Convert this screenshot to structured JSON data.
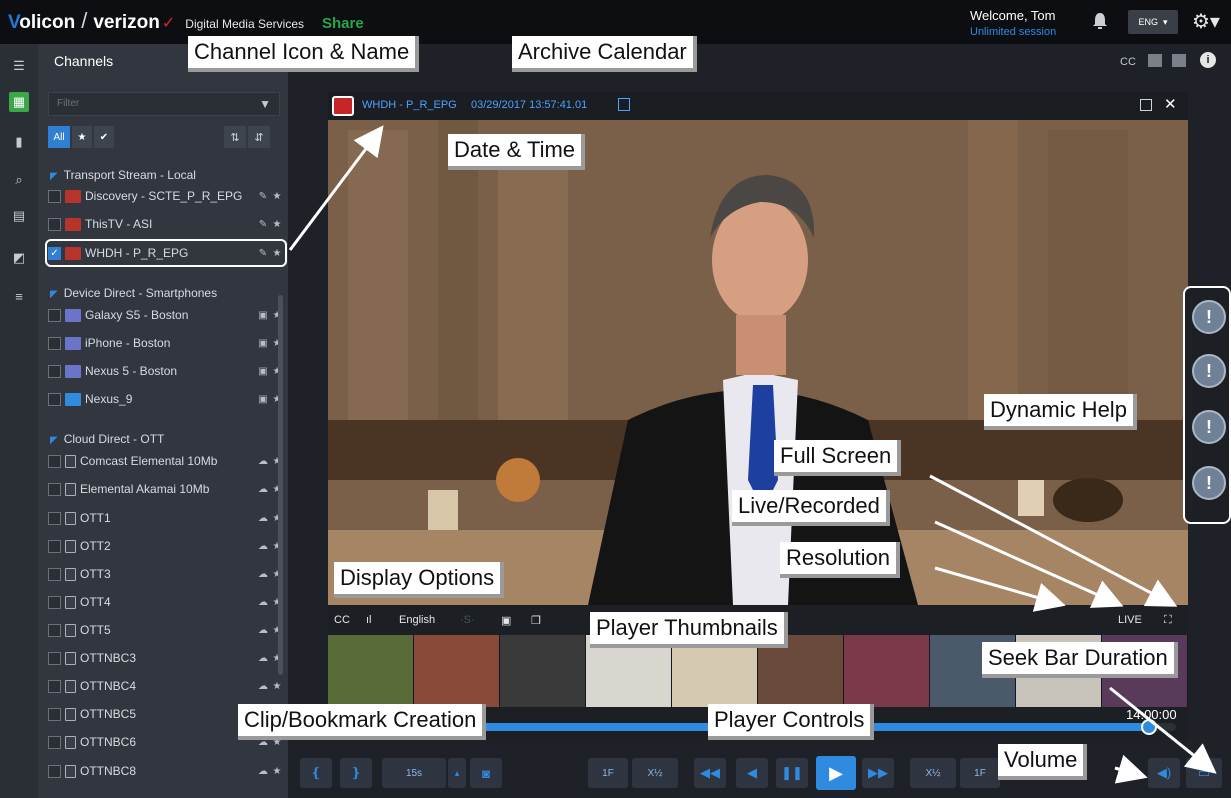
{
  "header": {
    "brand_volicon": "olicon",
    "brand_volicon_v": "V",
    "brand_slash": "/",
    "brand_verizon": "verizon",
    "brand_check": "✓",
    "brand_service": "Digital Media Services",
    "share": "Share",
    "welcome": "Welcome, Tom",
    "session": "Unlimited session",
    "lang": "ENG"
  },
  "panel": {
    "title": "Channels",
    "filter_placeholder": "Filter",
    "tabs": {
      "all": "All"
    },
    "groups": [
      {
        "label": "Transport Stream - Local"
      },
      {
        "label": "Device Direct - Smartphones"
      },
      {
        "label": "Cloud Direct - OTT"
      }
    ],
    "channels": [
      {
        "name": "Discovery - SCTE_P_R_EPG",
        "icon": "tv-logo-icon",
        "checked": false
      },
      {
        "name": "ThisTV - ASI",
        "icon": "tv-logo-icon",
        "checked": false
      },
      {
        "name": "WHDH - P_R_EPG",
        "icon": "tv-logo-icon",
        "checked": true
      },
      {
        "name": "Galaxy S5 - Boston",
        "icon": "phone-icon",
        "checked": false
      },
      {
        "name": "iPhone - Boston",
        "icon": "phone-icon",
        "checked": false
      },
      {
        "name": "Nexus 5 - Boston",
        "icon": "phone-icon",
        "checked": false
      },
      {
        "name": "Nexus_9",
        "icon": "tablet-icon",
        "checked": false
      },
      {
        "name": "Comcast Elemental 10Mb",
        "icon": "box-icon",
        "checked": false
      },
      {
        "name": "Elemental Akamai 10Mb",
        "icon": "box-icon",
        "checked": false
      },
      {
        "name": "OTT1",
        "icon": "box-icon",
        "checked": false
      },
      {
        "name": "OTT2",
        "icon": "box-icon",
        "checked": false
      },
      {
        "name": "OTT3",
        "icon": "box-icon",
        "checked": false
      },
      {
        "name": "OTT4",
        "icon": "box-icon",
        "checked": false
      },
      {
        "name": "OTT5",
        "icon": "box-icon",
        "checked": false
      },
      {
        "name": "OTTNBC3",
        "icon": "box-icon",
        "checked": false
      },
      {
        "name": "OTTNBC4",
        "icon": "box-icon",
        "checked": false
      },
      {
        "name": "OTTNBC5",
        "icon": "box-icon",
        "checked": false
      },
      {
        "name": "OTTNBC6",
        "icon": "box-icon",
        "checked": false
      },
      {
        "name": "OTTNBC8",
        "icon": "box-icon",
        "checked": false
      }
    ]
  },
  "player": {
    "channel": "WHDH - P_R_EPG",
    "datetime": "03/29/2017 13:57:41.01",
    "osd": {
      "cc": "CC",
      "signal": "ıl",
      "language": "English",
      "live": "LIVE"
    },
    "duration": "14:00:00",
    "seek_fraction": 0.97,
    "controls": {
      "skip": "15s",
      "frame_back": "1F",
      "half_back": "X½",
      "half_fwd": "X½",
      "frame_fwd": "1F"
    }
  },
  "toolbar": {
    "cc": "CC"
  },
  "annotations": {
    "channel_icon_name": "Channel Icon & Name",
    "archive_calendar": "Archive Calendar",
    "date_time": "Date & Time",
    "dynamic_help": "Dynamic Help",
    "full_screen": "Full Screen",
    "live_recorded": "Live/Recorded",
    "resolution": "Resolution",
    "display_options": "Display Options",
    "player_thumbnails": "Player Thumbnails",
    "seek_bar_duration": "Seek Bar Duration",
    "clip_bookmark": "Clip/Bookmark Creation",
    "player_controls": "Player Controls",
    "volume": "Volume"
  },
  "colors": {
    "accent": "#2f8be0",
    "brand_red": "#e3202a",
    "share_green": "#28a745",
    "active_rail": "#3aa848"
  }
}
